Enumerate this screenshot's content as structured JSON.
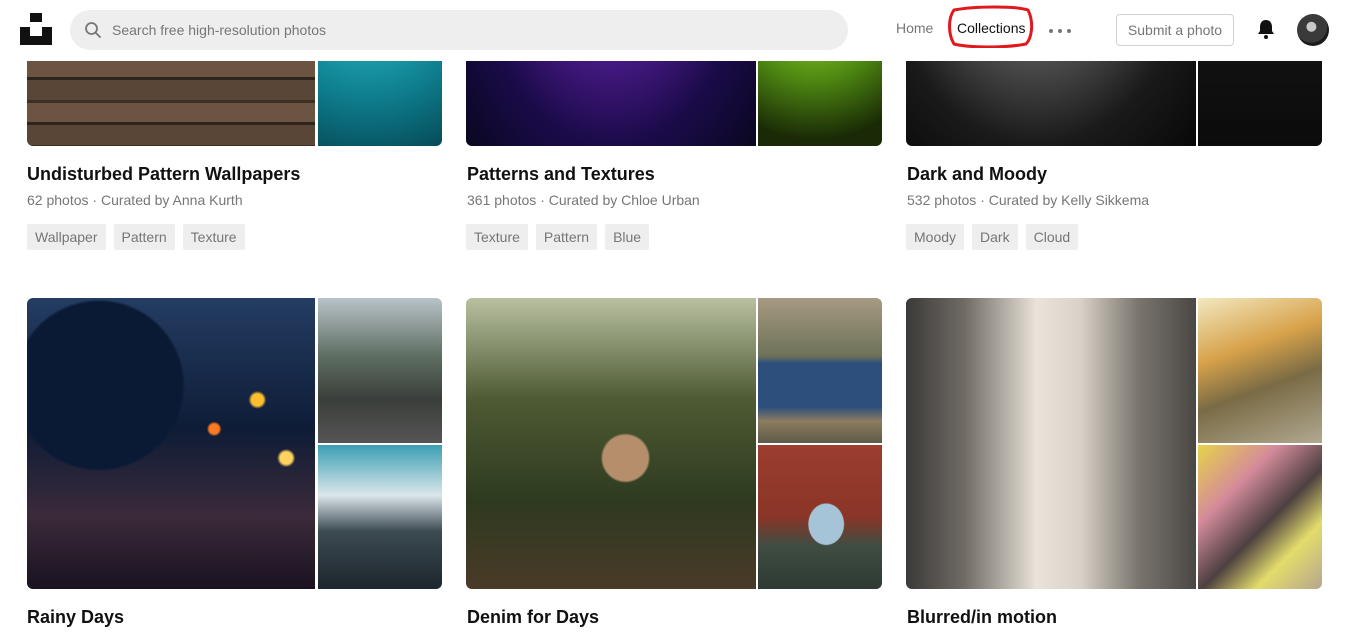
{
  "header": {
    "search_placeholder": "Search free high-resolution photos",
    "nav_home": "Home",
    "nav_collections": "Collections",
    "submit_label": "Submit a photo",
    "icons": [
      "unsplash-logo",
      "search-icon",
      "more-icon",
      "bell-icon",
      "avatar"
    ]
  },
  "collections": [
    {
      "title": "Undisturbed Pattern Wallpapers",
      "photos": "62 photos",
      "curator": "Curated by Anna Kurth",
      "tags": [
        "Wallpaper",
        "Pattern",
        "Texture"
      ]
    },
    {
      "title": "Patterns and Textures",
      "photos": "361 photos",
      "curator": "Curated by Chloe Urban",
      "tags": [
        "Texture",
        "Pattern",
        "Blue"
      ]
    },
    {
      "title": "Dark and Moody",
      "photos": "532 photos",
      "curator": "Curated by Kelly Sikkema",
      "tags": [
        "Moody",
        "Dark",
        "Cloud"
      ]
    },
    {
      "title": "Rainy Days"
    },
    {
      "title": "Denim for Days"
    },
    {
      "title": "Blurred/in motion"
    }
  ],
  "meta_separator": "·",
  "colors": {
    "accent_circle": "#e0191f",
    "muted_text": "#767676",
    "tag_bg": "#eeeeee"
  }
}
